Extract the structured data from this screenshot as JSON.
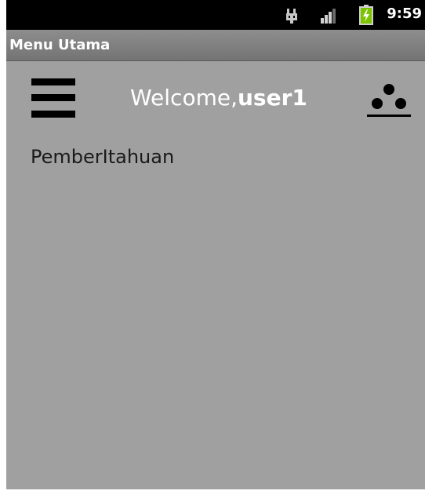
{
  "status_bar": {
    "time": "9:59",
    "icons": [
      "usb-icon",
      "signal-icon",
      "battery-charging-icon"
    ]
  },
  "title_bar": {
    "title": "Menu Utama"
  },
  "header": {
    "welcome_prefix": "Welcome,",
    "username": "user1",
    "menu_icon": "hamburger-menu-icon",
    "share_icon": "share-icon"
  },
  "content": {
    "notification_label": "PemberItahuan"
  },
  "colors": {
    "background": "#a0a0a0",
    "status_bar": "#000000",
    "title_bar": "#7f7f7f",
    "accent_battery": "#7cc300"
  }
}
